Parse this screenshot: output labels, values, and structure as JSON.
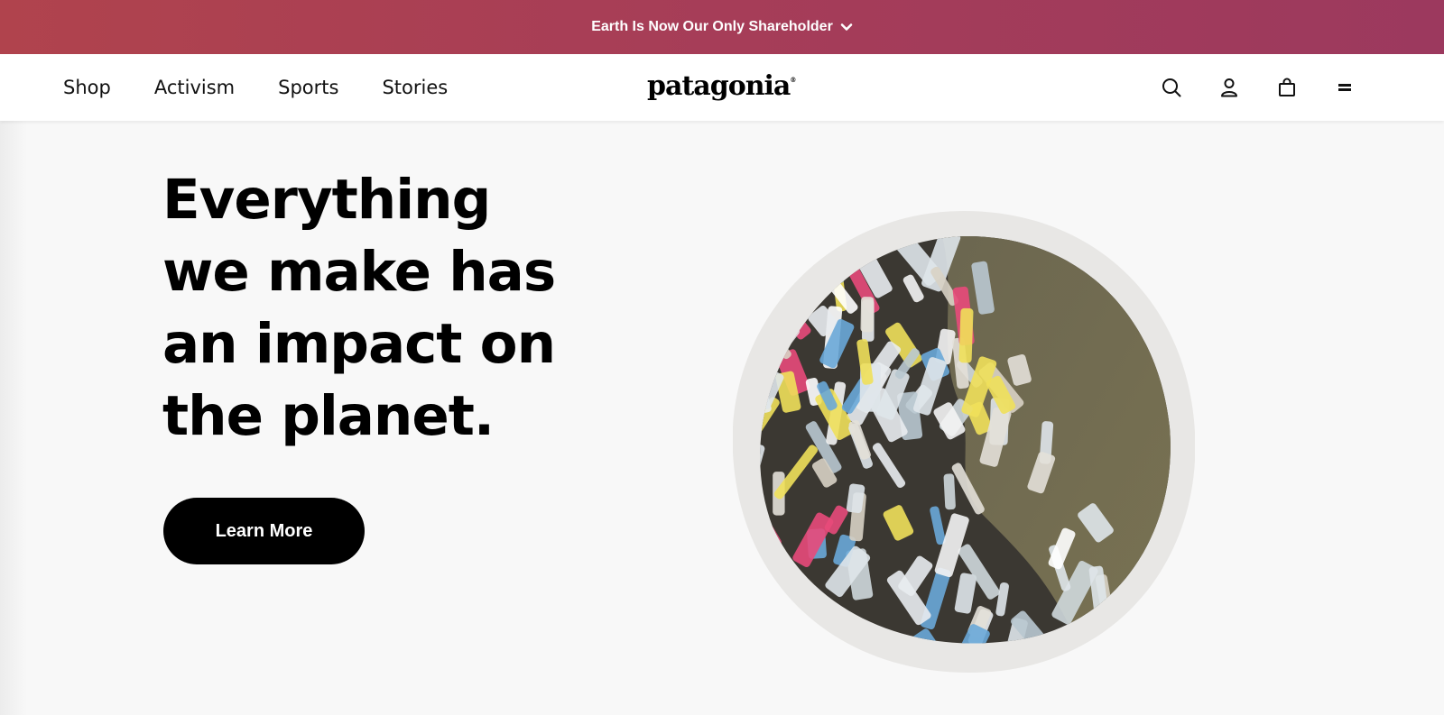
{
  "promo": {
    "text": "Earth Is Now Our Only Shareholder",
    "icon": "chevron-down-icon"
  },
  "nav": {
    "links": [
      "Shop",
      "Activism",
      "Sports",
      "Stories"
    ],
    "logo": "patagonia",
    "icons": [
      "search-icon",
      "account-icon",
      "bag-icon",
      "menu-icon"
    ]
  },
  "hero": {
    "headline": "Everything we make has an impact on the planet.",
    "cta_label": "Learn More",
    "image_alt_name": "plastic-waste-image"
  },
  "colors": {
    "promo_start": "#b0434d",
    "promo_end": "#9c395e",
    "cta_bg": "#000000",
    "page_bg": "#f8f8f8"
  }
}
